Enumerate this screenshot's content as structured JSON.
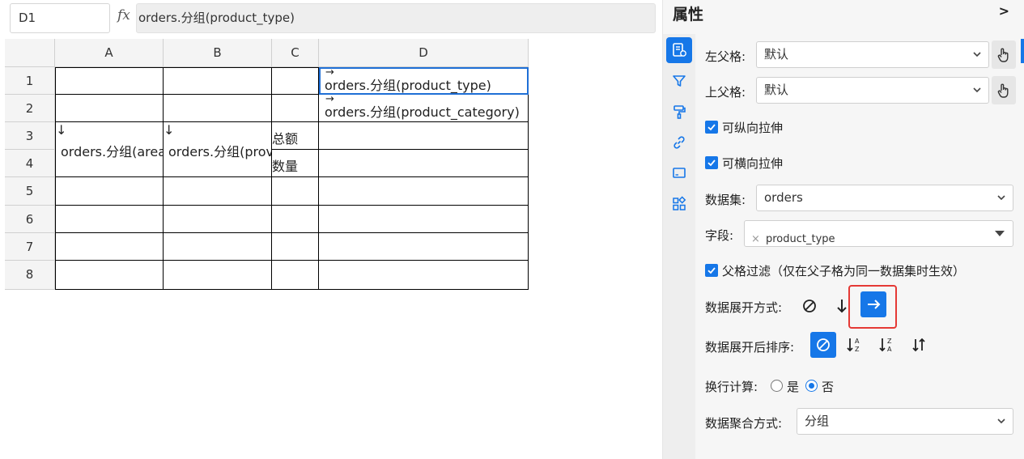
{
  "formula_bar": {
    "cell_ref": "D1",
    "fx_symbol": "fx",
    "formula": "orders.分组(product_type)"
  },
  "sheet": {
    "columns": [
      "A",
      "B",
      "C",
      "D"
    ],
    "rows": [
      "1",
      "2",
      "3",
      "4",
      "5",
      "6",
      "7",
      "8"
    ],
    "cells": {
      "D1": "orders.分组(product_type)",
      "D2": "orders.分组(product_category)",
      "A3": "orders.分组(area",
      "B3": "orders.分组(prov",
      "C3": "总额",
      "C4": "数量"
    },
    "arrow_right": "→",
    "arrow_down": "↓"
  },
  "panel": {
    "title": "属性",
    "collapse_glyph": ">",
    "left_parent_label": "左父格:",
    "left_parent_value": "默认",
    "top_parent_label": "上父格:",
    "top_parent_value": "默认",
    "vertical_stretch_label": "可纵向拉伸",
    "horizontal_stretch_label": "可横向拉伸",
    "dataset_label": "数据集:",
    "dataset_value": "orders",
    "field_label": "字段:",
    "field_tag": "product_type",
    "field_tag_remove": "×",
    "parent_filter_label": "父格过滤（仅在父子格为同一数据集时生效）",
    "expand_mode_label": "数据展开方式:",
    "expand_mode_selected": "horizontal",
    "sort_label": "数据展开后排序:",
    "sort_selected": "none",
    "row_calc_label": "换行计算:",
    "row_calc_yes": "是",
    "row_calc_no": "否",
    "row_calc_selected": "否",
    "aggregate_label": "数据聚合方式:",
    "aggregate_value": "分组",
    "accent_color": "#1677e8",
    "highlight_color": "#e53935"
  }
}
